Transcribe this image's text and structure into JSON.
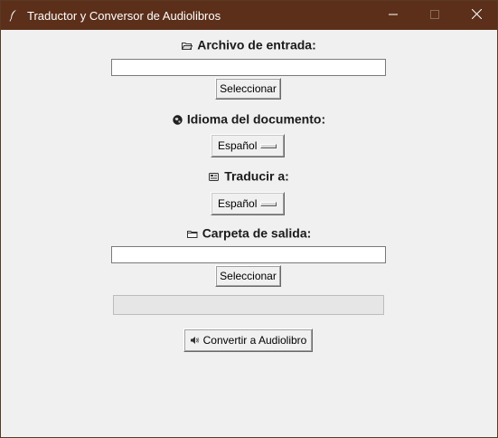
{
  "window": {
    "title": "Traductor y Conversor de Audiolibros",
    "icons": {
      "app": "feather-icon",
      "minimize": "minimize-icon",
      "maximize": "maximize-icon",
      "close": "close-icon"
    }
  },
  "input_file": {
    "label": "Archivo de entrada:",
    "icon": "folder-open-icon",
    "value": "",
    "button_label": "Seleccionar"
  },
  "document_language": {
    "label": "Idioma del documento:",
    "icon": "globe-icon",
    "selected": "Español"
  },
  "translate_to": {
    "label": "Traducir a:",
    "icon": "translate-icon",
    "selected": "Español"
  },
  "output_folder": {
    "label": "Carpeta de salida:",
    "icon": "folder-icon",
    "value": "",
    "button_label": "Seleccionar"
  },
  "progress": {
    "value": 0
  },
  "convert": {
    "label": "Convertir a Audiolibro",
    "icon": "speaker-icon"
  },
  "colors": {
    "titlebar": "#5c2f1a",
    "background": "#f0f0f0",
    "progress_fill": "#06b025"
  }
}
